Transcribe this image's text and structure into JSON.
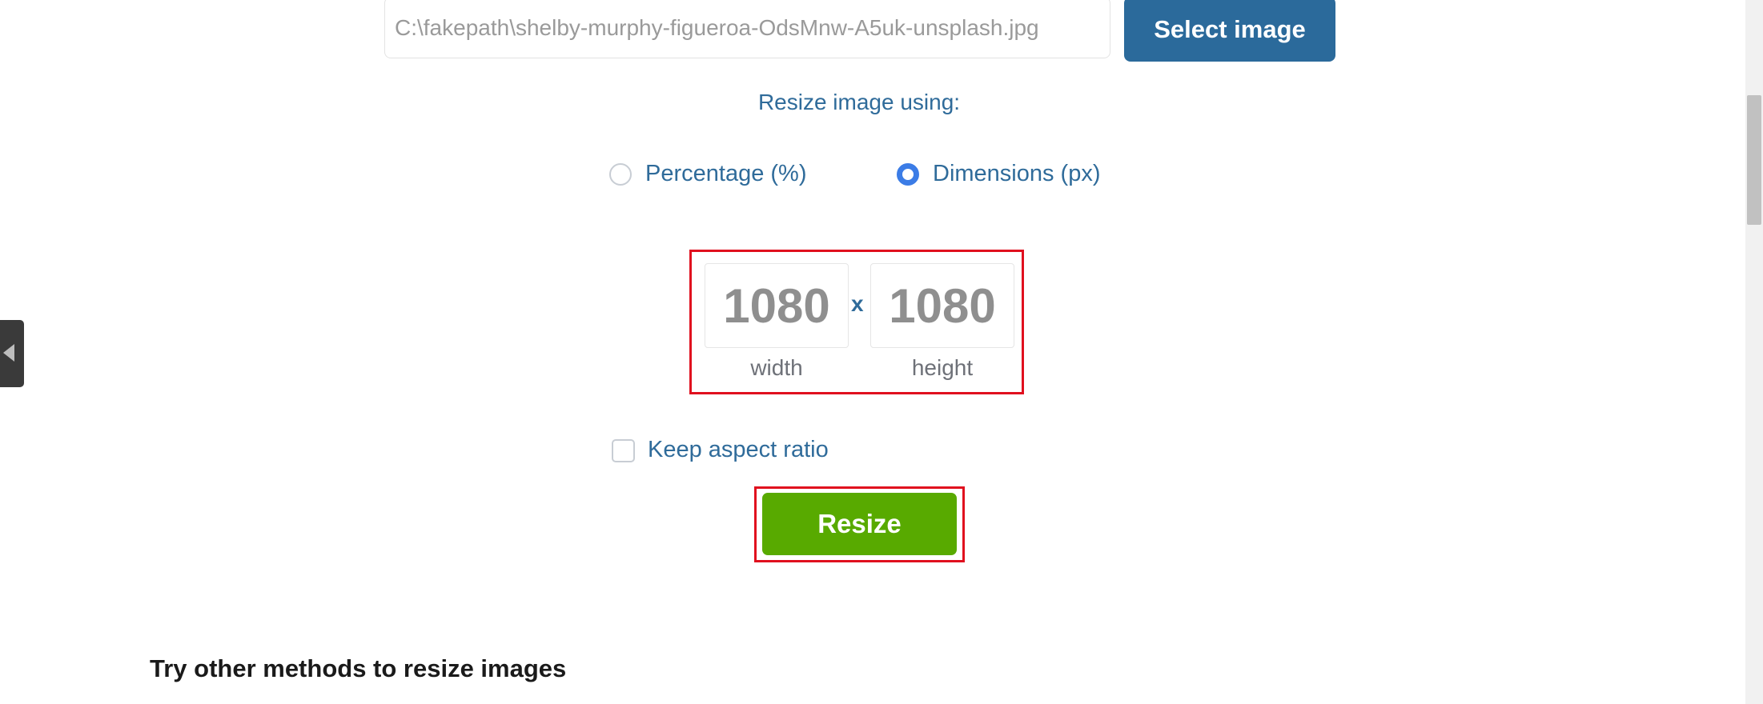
{
  "file_input": {
    "value": "C:\\fakepath\\shelby-murphy-figueroa-OdsMnw-A5uk-unsplash.jpg"
  },
  "select_button": "Select image",
  "resize_using": "Resize image using:",
  "radios": [
    {
      "label": "Percentage (%)",
      "selected": false
    },
    {
      "label": "Dimensions (px)",
      "selected": true
    }
  ],
  "dimensions": {
    "width": "1080",
    "height": "1080",
    "separator": "x",
    "width_label": "width",
    "height_label": "height"
  },
  "keep_aspect": {
    "label": "Keep aspect ratio",
    "checked": false
  },
  "resize_button": "Resize",
  "heading": "Try other methods to resize images",
  "colors": {
    "primary": "#2b6a9b",
    "resize": "#58aa00",
    "highlight": "#e0101e",
    "radio_selected": "#3b7ce6"
  }
}
